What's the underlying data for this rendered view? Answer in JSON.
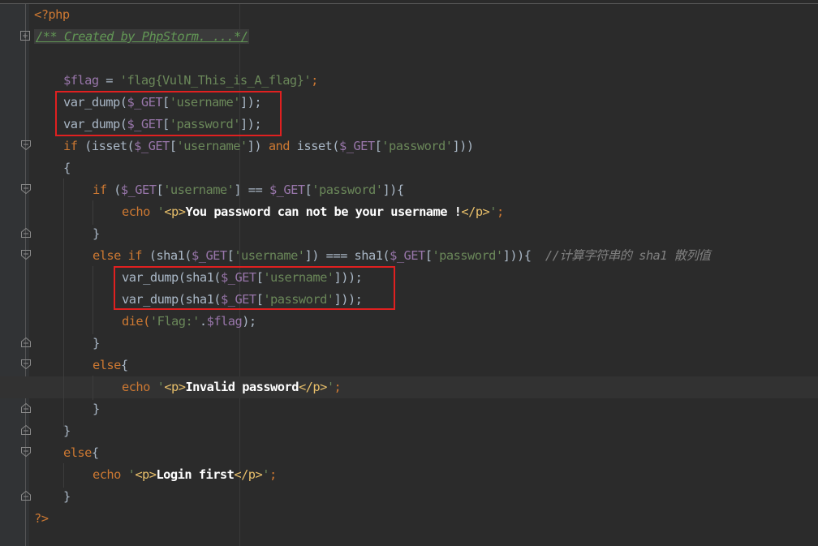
{
  "editor": {
    "open_tag": "<?php",
    "close_tag": "?>",
    "doc_comment_collapsed": "/** Created by PhpStorm. ...*/",
    "lines": {
      "l4_var": "$flag",
      "l4_assign": " = ",
      "l4_str": "'flag{VulN_This_is_A_flag}'",
      "l4_end": ";",
      "l5_fn": "var_dump(",
      "l5_var": "$_GET",
      "l5_b1": "[",
      "l5_str": "'username'",
      "l5_end": "]);",
      "l6_fn": "var_dump(",
      "l6_var": "$_GET",
      "l6_b1": "[",
      "l6_str": "'password'",
      "l6_end": "]);",
      "l7_if": "if",
      "l7_a": " (isset(",
      "l7_var1": "$_GET",
      "l7_b1": "[",
      "l7_str1": "'username'",
      "l7_b2": "]) ",
      "l7_and": "and",
      "l7_c": " isset(",
      "l7_var2": "$_GET",
      "l7_b3": "[",
      "l7_str2": "'password'",
      "l7_end": "]))",
      "l8_brace": "{",
      "l9_if": "if",
      "l9_a": " (",
      "l9_var1": "$_GET",
      "l9_b1": "[",
      "l9_str1": "'username'",
      "l9_b2": "] == ",
      "l9_var2": "$_GET",
      "l9_b3": "[",
      "l9_str2": "'password'",
      "l9_end": "]){",
      "l10_echo": "echo",
      "l10_q1": " '",
      "l10_tag1": "<p>",
      "l10_text": "You password can not be your username !",
      "l10_tag2": "</p>",
      "l10_q2": "'",
      "l10_end": ";",
      "l11_brace": "}",
      "l12_else": "else if",
      "l12_a": " (sha1(",
      "l12_var1": "$_GET",
      "l12_b1": "[",
      "l12_str1": "'username'",
      "l12_b2": "]) ",
      "l12_op": "===",
      "l12_c": " sha1(",
      "l12_var2": "$_GET",
      "l12_b3": "[",
      "l12_str2": "'password'",
      "l12_end": "])){  ",
      "l12_comment": "//计算字符串的 sha1 散列值",
      "l13_fn": "var_dump(sha1(",
      "l13_var": "$_GET",
      "l13_b1": "[",
      "l13_str": "'username'",
      "l13_end": "]));",
      "l14_fn": "var_dump(sha1(",
      "l14_var": "$_GET",
      "l14_b1": "[",
      "l14_str": "'password'",
      "l14_end": "]));",
      "l15_die": "die(",
      "l15_str": "'Flag:'",
      "l15_dot": ".",
      "l15_var": "$flag",
      "l15_end": ");",
      "l16_brace": "}",
      "l17_else": "else",
      "l17_brace": "{",
      "l18_echo": "echo",
      "l18_q1": " '",
      "l18_tag1": "<p>",
      "l18_text": "Invalid password",
      "l18_tag2": "</p>",
      "l18_q2": "'",
      "l18_end": ";",
      "l19_brace": "}",
      "l20_brace": "}",
      "l21_else": "else",
      "l21_brace": "{",
      "l22_echo": "echo",
      "l22_q1": " '",
      "l22_tag1": "<p>",
      "l22_text": "Login first",
      "l22_tag2": "</p>",
      "l22_q2": "'",
      "l22_end": ";",
      "l23_brace": "}"
    }
  },
  "colors": {
    "background": "#2b2b2b",
    "keyword": "#cc7832",
    "variable": "#9876aa",
    "string": "#6a8759",
    "html_tag": "#e8bf6a",
    "comment": "#808080",
    "highlight_box": "#e02020"
  },
  "icons": [
    "fold-expand-icon",
    "fold-start-icon",
    "fold-end-icon"
  ]
}
